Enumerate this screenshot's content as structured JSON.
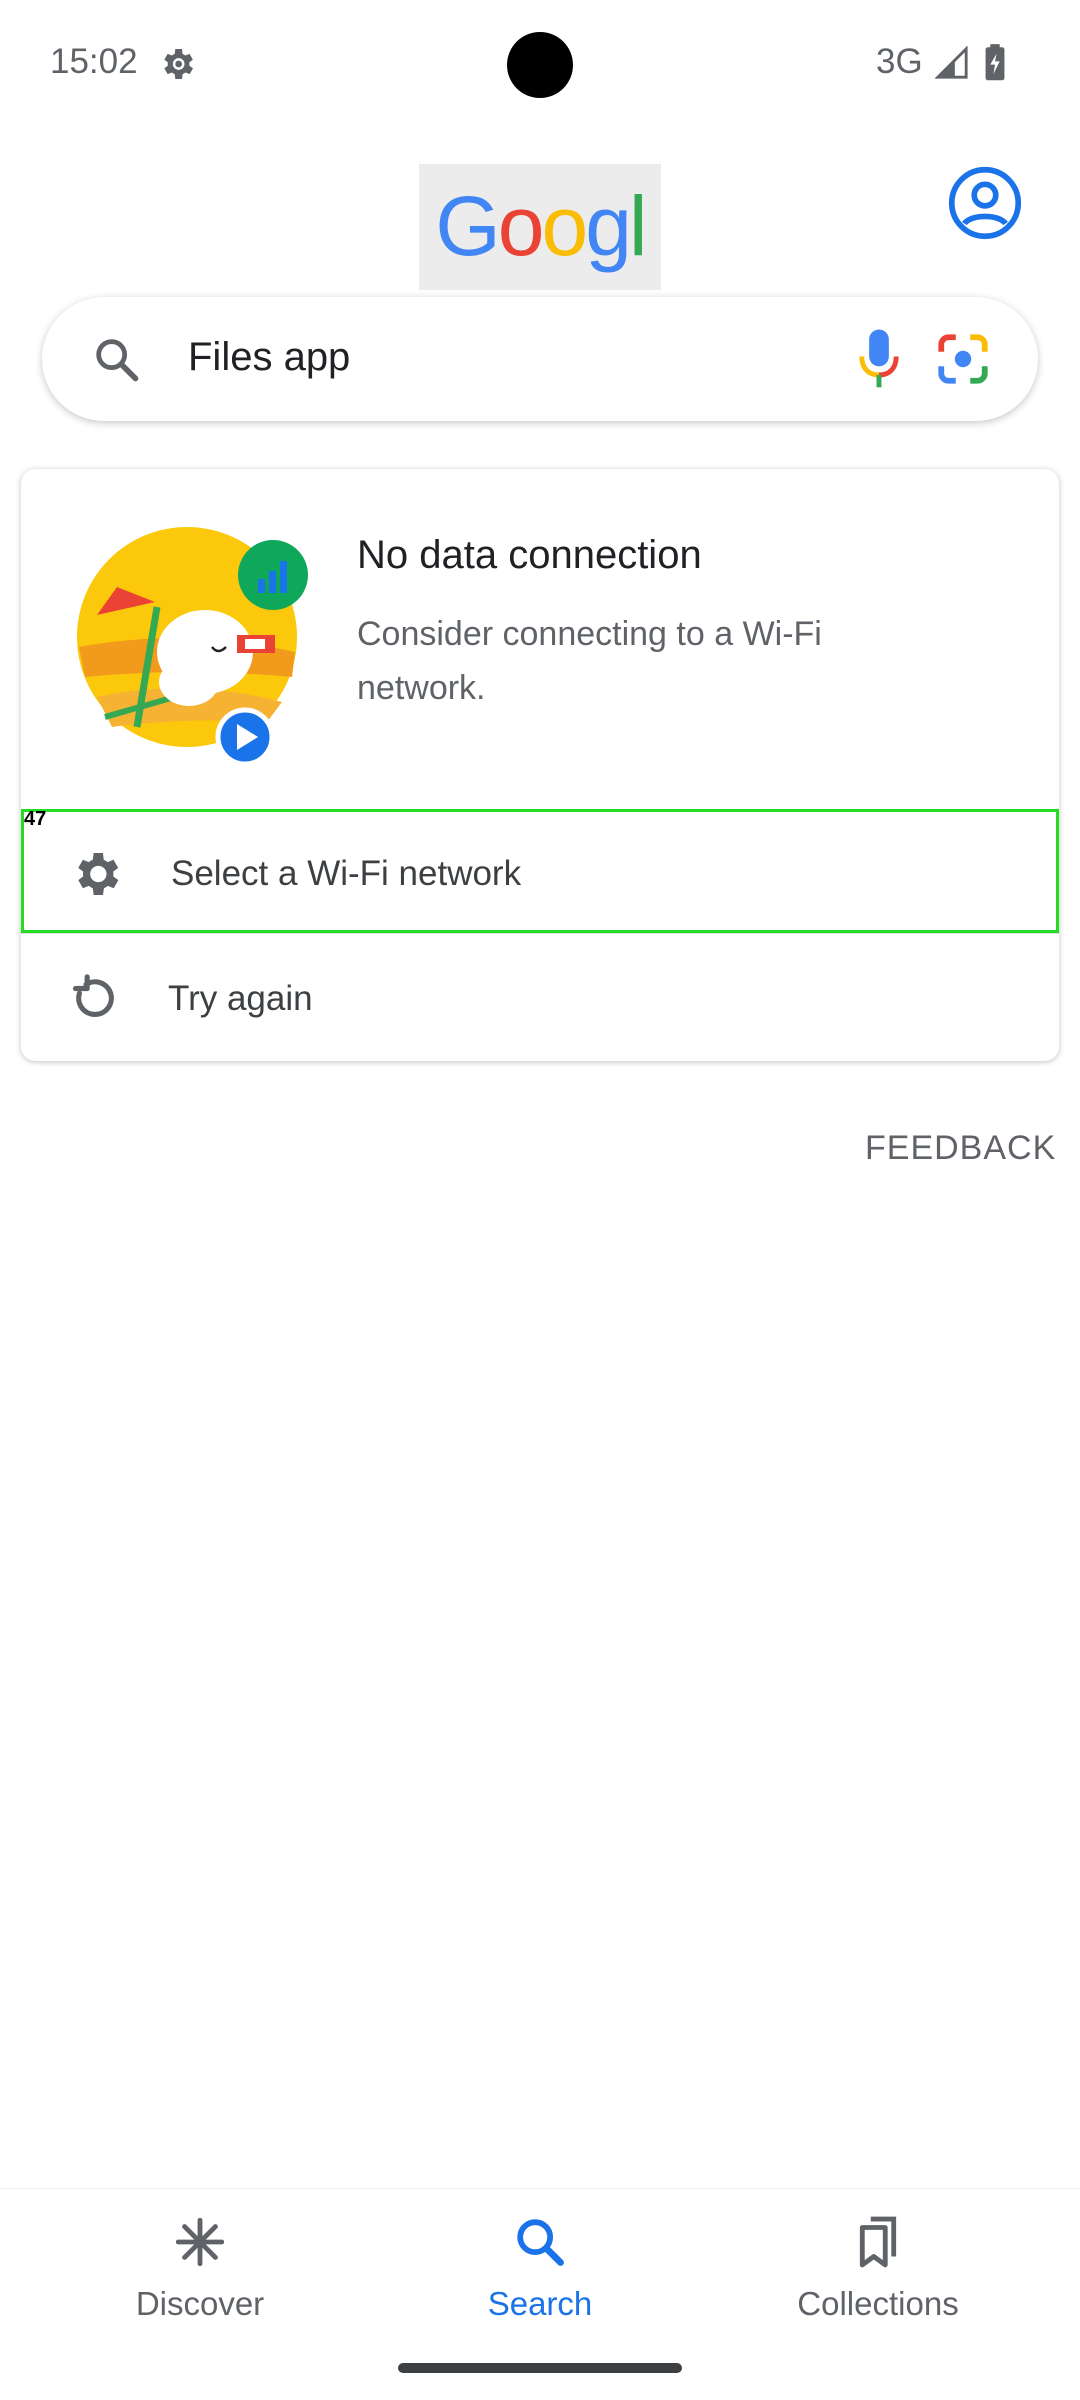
{
  "status_bar": {
    "time": "15:02",
    "network": "3G",
    "icons": [
      "settings-gear-icon",
      "signal-icon",
      "battery-charging-icon"
    ]
  },
  "header": {
    "logo": "Google",
    "account_icon": "account-circle-icon"
  },
  "search": {
    "query": "Files app",
    "icons": [
      "search-icon",
      "mic-icon",
      "lens-icon"
    ]
  },
  "error_card": {
    "title": "No data connection",
    "body": "Consider connecting to a Wi-Fi network.",
    "actions": [
      {
        "label": "Select a Wi-Fi network",
        "icon": "settings-gear-icon",
        "annotation": "47"
      },
      {
        "label": "Try again",
        "icon": "refresh-icon"
      }
    ]
  },
  "feedback_label": "FEEDBACK",
  "bottom_nav": {
    "items": [
      {
        "label": "Discover",
        "icon": "discover-asterisk-icon"
      },
      {
        "label": "Search",
        "icon": "search-icon",
        "active": true
      },
      {
        "label": "Collections",
        "icon": "collections-bookmark-icon"
      }
    ]
  },
  "colors": {
    "accent": "#1a73e8",
    "highlight": "#22dd22",
    "text_secondary": "#5f6368"
  }
}
